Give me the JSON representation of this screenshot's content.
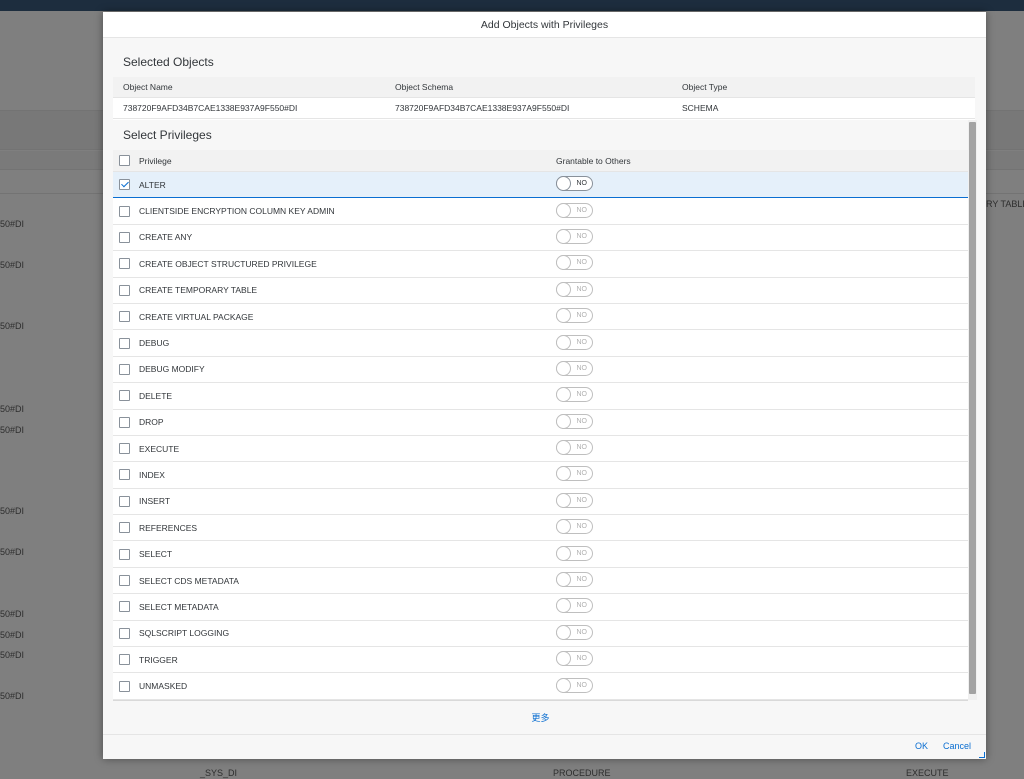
{
  "background": {
    "rows_text": [
      "50#DI",
      "50#DI",
      "50#DI",
      "50#DI",
      "50#DI",
      "50#DI",
      "50#DI",
      "50#DI",
      "50#DI",
      "50#DI",
      "50#DI"
    ],
    "right_label": "RY TABLE",
    "bottom_left": "_SYS_DI",
    "bottom_mid": "PROCEDURE",
    "bottom_right": "EXECUTE"
  },
  "dialog": {
    "title": "Add Objects with Privileges",
    "selected_objects": {
      "title": "Selected Objects",
      "columns": [
        "Object Name",
        "Object Schema",
        "Object Type"
      ],
      "row": [
        "738720F9AFD34B7CAE1338E937A9F550#DI",
        "738720F9AFD34B7CAE1338E937A9F550#DI",
        "SCHEMA"
      ]
    },
    "privileges": {
      "title": "Select Privileges",
      "col_privilege": "Privilege",
      "col_grantable": "Grantable to Others",
      "toggle_label": "NO",
      "items": [
        {
          "name": "ALTER",
          "checked": true
        },
        {
          "name": "CLIENTSIDE ENCRYPTION COLUMN KEY ADMIN",
          "checked": false
        },
        {
          "name": "CREATE ANY",
          "checked": false
        },
        {
          "name": "CREATE OBJECT STRUCTURED PRIVILEGE",
          "checked": false
        },
        {
          "name": "CREATE TEMPORARY TABLE",
          "checked": false
        },
        {
          "name": "CREATE VIRTUAL PACKAGE",
          "checked": false
        },
        {
          "name": "DEBUG",
          "checked": false
        },
        {
          "name": "DEBUG MODIFY",
          "checked": false
        },
        {
          "name": "DELETE",
          "checked": false
        },
        {
          "name": "DROP",
          "checked": false
        },
        {
          "name": "EXECUTE",
          "checked": false
        },
        {
          "name": "INDEX",
          "checked": false
        },
        {
          "name": "INSERT",
          "checked": false
        },
        {
          "name": "REFERENCES",
          "checked": false
        },
        {
          "name": "SELECT",
          "checked": false
        },
        {
          "name": "SELECT CDS METADATA",
          "checked": false
        },
        {
          "name": "SELECT METADATA",
          "checked": false
        },
        {
          "name": "SQLSCRIPT LOGGING",
          "checked": false
        },
        {
          "name": "TRIGGER",
          "checked": false
        },
        {
          "name": "UNMASKED",
          "checked": false
        }
      ]
    },
    "more_label": "更多",
    "ok_label": "OK",
    "cancel_label": "Cancel"
  }
}
